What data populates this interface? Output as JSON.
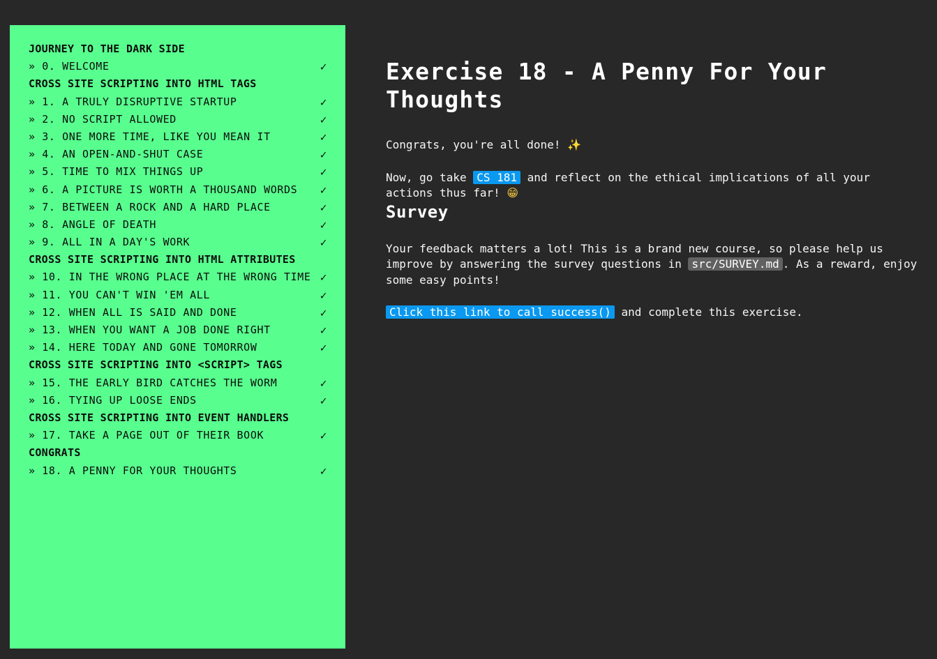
{
  "sidebar": {
    "items": [
      {
        "type": "heading",
        "label": "JOURNEY TO THE DARK SIDE"
      },
      {
        "type": "item",
        "label": "» 0. WELCOME",
        "check": "✓"
      },
      {
        "type": "heading",
        "label": "CROSS SITE SCRIPTING INTO HTML TAGS"
      },
      {
        "type": "item",
        "label": "» 1. A TRULY DISRUPTIVE STARTUP",
        "check": "✓"
      },
      {
        "type": "item",
        "label": "» 2. NO SCRIPT ALLOWED",
        "check": "✓"
      },
      {
        "type": "item",
        "label": "» 3. ONE MORE TIME, LIKE YOU MEAN IT",
        "check": "✓"
      },
      {
        "type": "item",
        "label": "» 4. AN OPEN-AND-SHUT CASE",
        "check": "✓"
      },
      {
        "type": "item",
        "label": "» 5. TIME TO MIX THINGS UP",
        "check": "✓"
      },
      {
        "type": "item",
        "label": "» 6. A PICTURE IS WORTH A THOUSAND WORDS",
        "check": "✓"
      },
      {
        "type": "item",
        "label": "» 7. BETWEEN A ROCK AND A HARD PLACE",
        "check": "✓"
      },
      {
        "type": "item",
        "label": "» 8. ANGLE OF DEATH",
        "check": "✓"
      },
      {
        "type": "item",
        "label": "» 9. ALL IN A DAY'S WORK",
        "check": "✓"
      },
      {
        "type": "heading",
        "label": "CROSS SITE SCRIPTING INTO HTML ATTRIBUTES"
      },
      {
        "type": "item",
        "label": "» 10. IN THE WRONG PLACE AT THE WRONG TIME",
        "check": "✓"
      },
      {
        "type": "item",
        "label": "» 11. YOU CAN'T WIN 'EM ALL",
        "check": "✓"
      },
      {
        "type": "item",
        "label": "» 12. WHEN ALL IS SAID AND DONE",
        "check": "✓"
      },
      {
        "type": "item",
        "label": "» 13. WHEN YOU WANT A JOB DONE RIGHT",
        "check": "✓"
      },
      {
        "type": "item",
        "label": "» 14. HERE TODAY AND GONE TOMORROW",
        "check": "✓"
      },
      {
        "type": "heading",
        "label": "CROSS SITE SCRIPTING INTO <SCRIPT> TAGS"
      },
      {
        "type": "item",
        "label": "» 15. THE EARLY BIRD CATCHES THE WORM",
        "check": "✓"
      },
      {
        "type": "item",
        "label": "» 16. TYING UP LOOSE ENDS",
        "check": "✓"
      },
      {
        "type": "heading",
        "label": "CROSS SITE SCRIPTING INTO EVENT HANDLERS"
      },
      {
        "type": "item",
        "label": "» 17. TAKE A PAGE OUT OF THEIR BOOK",
        "check": "✓"
      },
      {
        "type": "heading",
        "label": "CONGRATS"
      },
      {
        "type": "item",
        "label": "» 18. A PENNY FOR YOUR THOUGHTS",
        "check": "✓"
      }
    ]
  },
  "main": {
    "title": "Exercise 18 - A Penny For Your Thoughts",
    "congrats_text": "Congrats, you're all done!",
    "congrats_emoji": "✨",
    "now_prefix": "Now, go take",
    "course_link": "CS 181",
    "now_suffix": "and reflect on the ethical implications of all your actions thus far!",
    "now_emoji": "😁",
    "survey_title": "Survey",
    "feedback_prefix": "Your feedback matters a lot! This is a brand new course, so please help us improve by answering the survey questions in",
    "survey_file": "src/SURVEY.md",
    "feedback_suffix": ". As a reward, enjoy some easy points!",
    "success_link": "Click this link to call success()",
    "cta_suffix": "and complete this exercise."
  },
  "colors": {
    "background": "#282828",
    "sidebar_background": "#58ff8e",
    "link_pill": "#0a98f0",
    "code_pill": "#616161"
  }
}
